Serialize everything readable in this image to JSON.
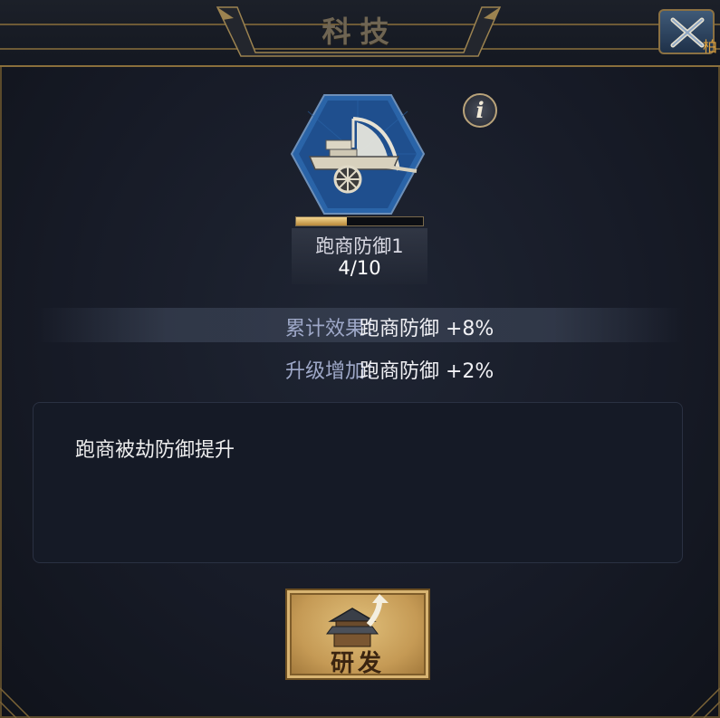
{
  "window": {
    "title": "科技",
    "close_side_text": "柏"
  },
  "tech": {
    "name": "跑商防御1",
    "level_text": "4/10",
    "progress": 0.4,
    "icon": "trade-cart-icon"
  },
  "stats": [
    {
      "label": "累计效果：",
      "value": "跑商防御 +8%"
    },
    {
      "label": "升级增加：",
      "value": "跑商防御 +2%"
    }
  ],
  "description": "跑商被劫防御提升",
  "buttons": {
    "info": "i",
    "research": "研发"
  },
  "colors": {
    "accent_gold": "#c59a55",
    "frame_gold": "#8a6f3c",
    "label_blue": "#9ea8c8",
    "hex_blue": "#2a64a8"
  }
}
